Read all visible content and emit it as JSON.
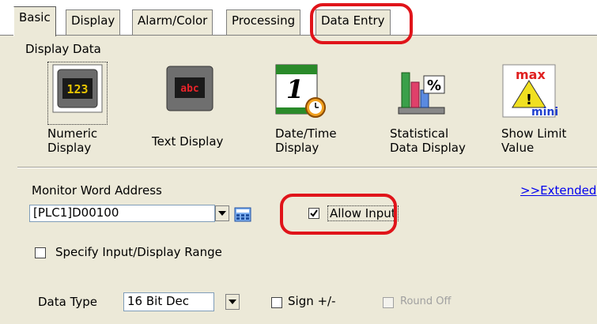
{
  "tabs": [
    {
      "label": "Basic"
    },
    {
      "label": "Display"
    },
    {
      "label": "Alarm/Color"
    },
    {
      "label": "Processing"
    },
    {
      "label": "Data Entry"
    }
  ],
  "display_data": {
    "heading": "Display Data",
    "items": [
      {
        "icon": "numeric-display-icon",
        "icon_text": "123",
        "label_line1": "Numeric",
        "label_line2": "Display"
      },
      {
        "icon": "text-display-icon",
        "icon_text": "abc",
        "label_line1": "Text Display",
        "label_line2": ""
      },
      {
        "icon": "date-time-display-icon",
        "icon_text": "1",
        "label_line1": "Date/Time",
        "label_line2": "Display"
      },
      {
        "icon": "statistical-data-display-icon",
        "icon_text": "%",
        "label_line1": "Statistical",
        "label_line2": "Data Display"
      },
      {
        "icon": "show-limit-value-icon",
        "icon_text_top": "max",
        "icon_text_mid": "!",
        "icon_text_bottom": "mini",
        "label_line1": "Show Limit",
        "label_line2": "Value"
      }
    ]
  },
  "monitor": {
    "label": "Monitor Word Address",
    "address_value": "[PLC1]D00100",
    "extended_link": ">>Extended",
    "allow_input_label": "Allow Input",
    "allow_input_checked": true
  },
  "range": {
    "label": "Specify Input/Display Range",
    "checked": false
  },
  "data_type": {
    "label": "Data Type",
    "value": "16 Bit Dec",
    "sign_label": "Sign +/-",
    "round_off_label": "Round Off"
  },
  "colors": {
    "panel_bg": "#ece9d8",
    "highlight_ring": "#e0141a",
    "link": "#0000ee"
  }
}
